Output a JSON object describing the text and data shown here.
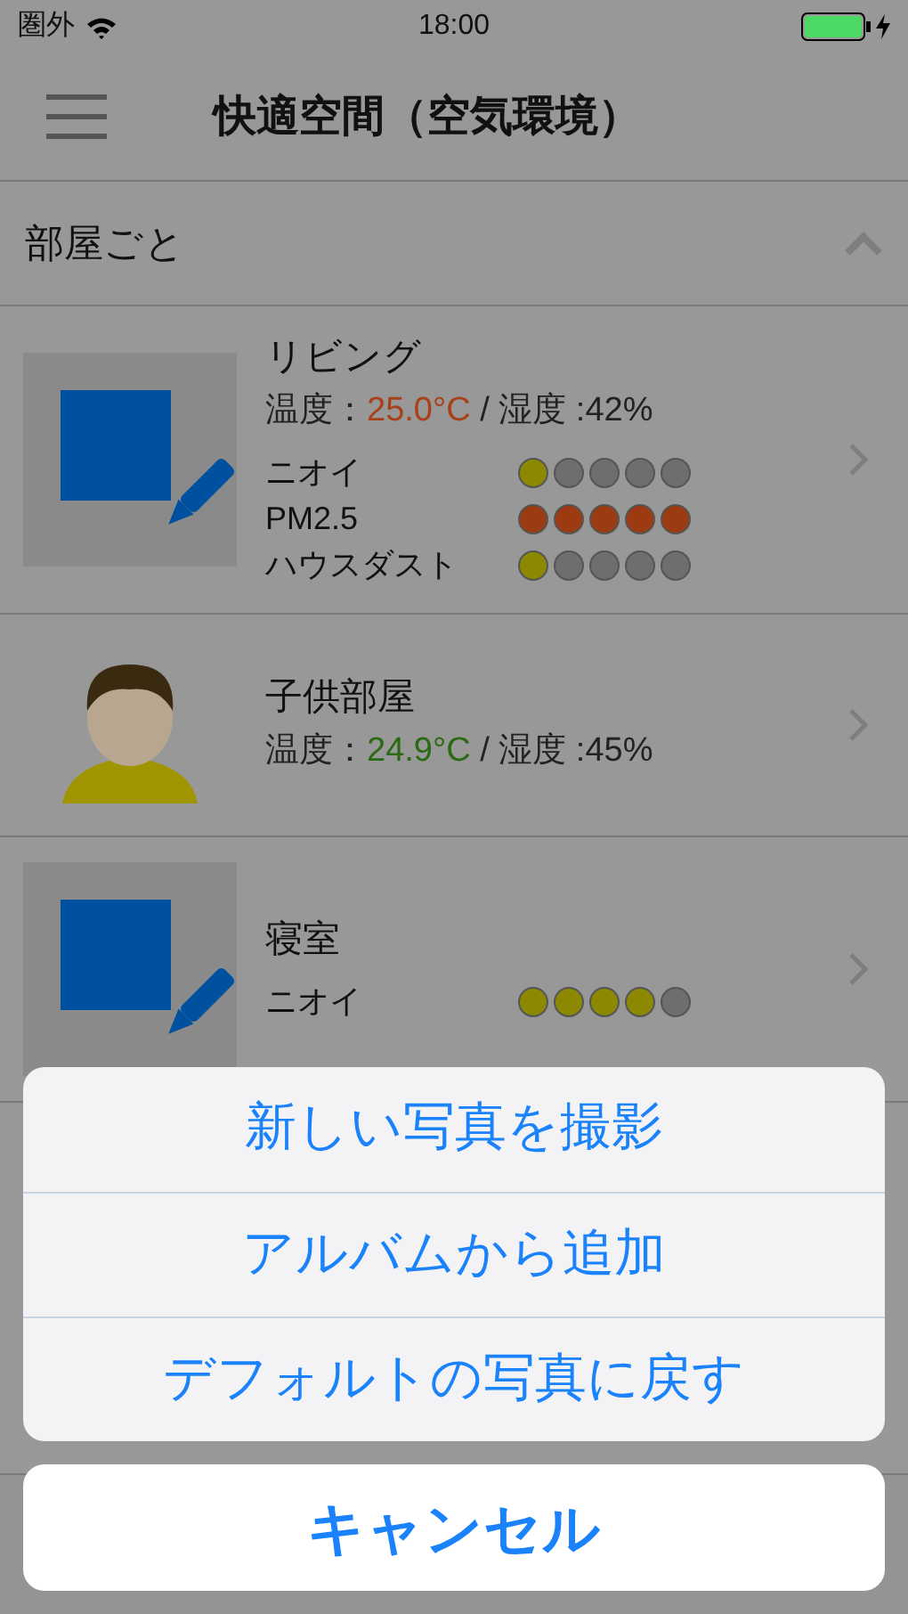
{
  "status_bar": {
    "carrier": "圏外",
    "time": "18:00"
  },
  "nav": {
    "title": "快適空間（空気環境）"
  },
  "section": {
    "title": "部屋ごと",
    "expanded": true
  },
  "rooms": [
    {
      "kind": "placeholder",
      "name": "リビング",
      "temp_label": "温度：",
      "temp": {
        "text": "25.0°C",
        "color": "#a8401a"
      },
      "humidity": " / 湿度 :42%",
      "metrics": [
        {
          "label": "ニオイ",
          "stars": 1,
          "color": "#8c8800"
        },
        {
          "label": "PM2.5",
          "stars": 5,
          "color": "#9c3a12"
        },
        {
          "label": "ハウスダスト",
          "stars": 1,
          "color": "#8c8800"
        }
      ]
    },
    {
      "kind": "avatar",
      "name": "子供部屋",
      "temp_label": "温度：",
      "temp": {
        "text": "24.9°C",
        "color": "#2a6a12"
      },
      "humidity": " / 湿度 :45%"
    },
    {
      "kind": "placeholder",
      "name": "寝室",
      "metrics": [
        {
          "label": "ニオイ",
          "stars": 4,
          "color": "#8c8800"
        }
      ]
    }
  ],
  "action_sheet": {
    "actions": [
      "新しい写真を撮影",
      "アルバムから追加",
      "デフォルトの写真に戻す"
    ],
    "cancel": "キャンセル"
  }
}
